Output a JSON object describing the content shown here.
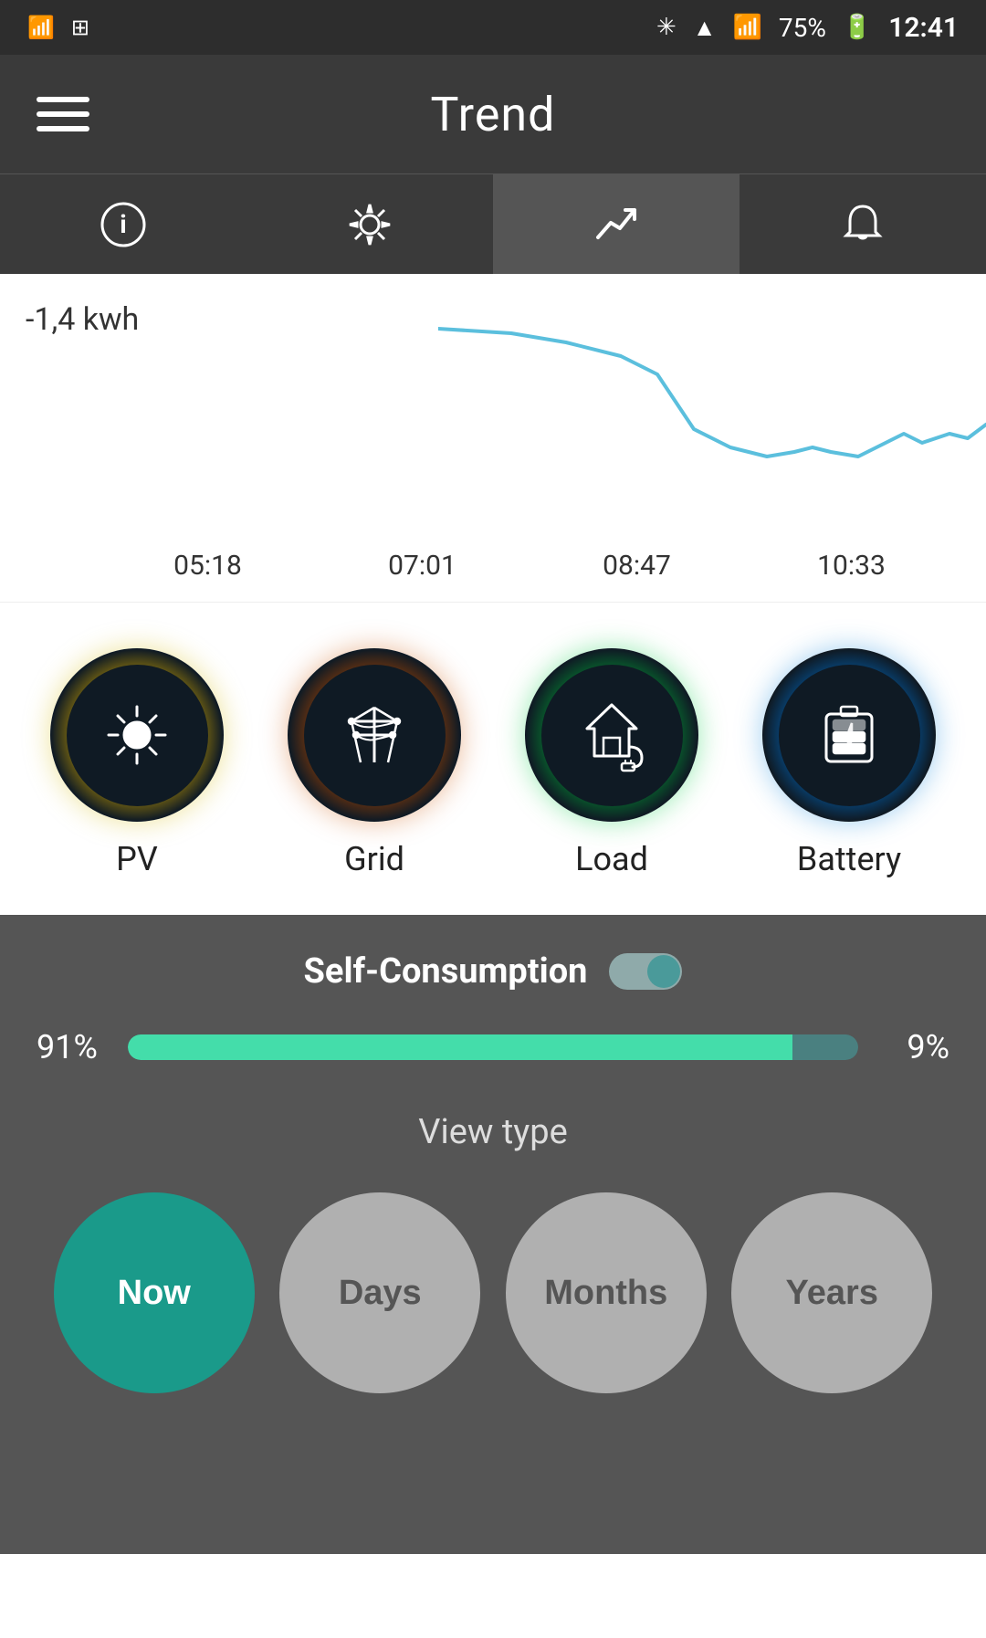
{
  "status_bar": {
    "left_icons": [
      "signal1",
      "signal2"
    ],
    "right_icons": [
      "bluetooth",
      "wifi",
      "signal",
      "battery"
    ],
    "time": "12:41",
    "battery_pct": "75%"
  },
  "header": {
    "title": "Trend",
    "menu_label": "Menu"
  },
  "nav": {
    "tabs": [
      {
        "label": "info",
        "icon": "ℹ",
        "active": false
      },
      {
        "label": "settings",
        "icon": "⚙",
        "active": false
      },
      {
        "label": "trend",
        "icon": "↗",
        "active": true
      },
      {
        "label": "bell",
        "icon": "🔔",
        "active": false
      }
    ]
  },
  "chart": {
    "value": "-1,4 kwh",
    "times": [
      "05:18",
      "07:01",
      "08:47",
      "10:33"
    ]
  },
  "energy_icons": [
    {
      "id": "pv",
      "label": "PV",
      "type": "pv"
    },
    {
      "id": "grid",
      "label": "Grid",
      "type": "grid"
    },
    {
      "id": "load",
      "label": "Load",
      "type": "load"
    },
    {
      "id": "battery",
      "label": "Battery",
      "type": "battery"
    }
  ],
  "self_consumption": {
    "label": "Self-Consumption",
    "enabled": true,
    "left_pct": "91%",
    "right_pct": "9%",
    "fill_pct": 91
  },
  "view_type": {
    "label": "View type",
    "buttons": [
      {
        "id": "now",
        "label": "Now",
        "active": true
      },
      {
        "id": "days",
        "label": "Days",
        "active": false
      },
      {
        "id": "months",
        "label": "Months",
        "active": false
      },
      {
        "id": "years",
        "label": "Years",
        "active": false
      }
    ]
  }
}
